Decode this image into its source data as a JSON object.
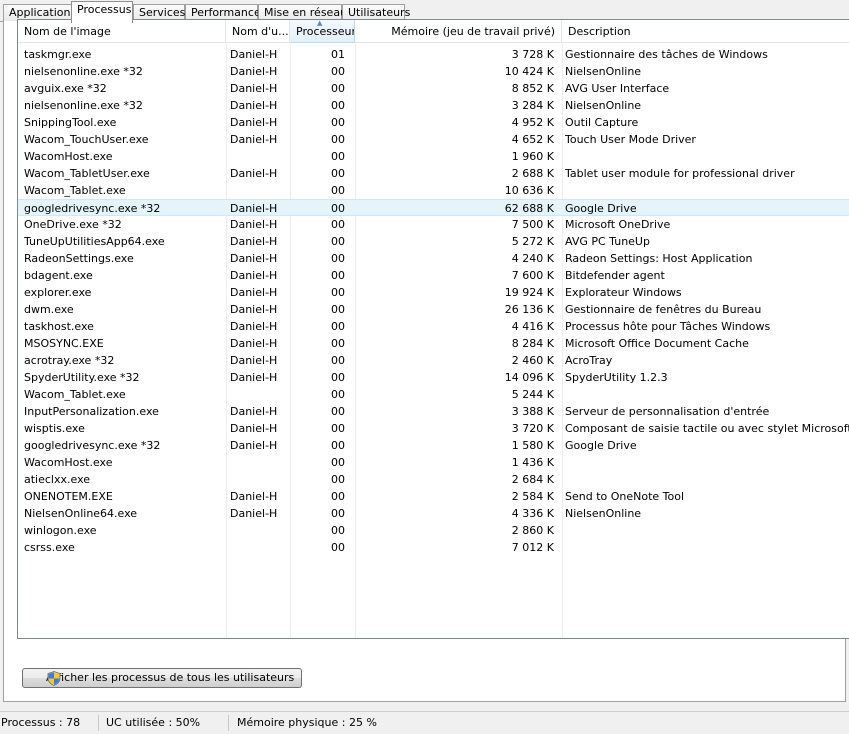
{
  "tabs": [
    {
      "label": "Applications",
      "active": false
    },
    {
      "label": "Processus",
      "active": true
    },
    {
      "label": "Services",
      "active": false
    },
    {
      "label": "Performance",
      "active": false
    },
    {
      "label": "Mise en réseau",
      "active": false
    },
    {
      "label": "Utilisateurs",
      "active": false
    }
  ],
  "columns": {
    "name": "Nom de l'image",
    "user": "Nom d'u...",
    "cpu": "Processeur",
    "mem": "Mémoire (jeu de travail privé)",
    "desc": "Description"
  },
  "sorted_column": "cpu",
  "selected_row": 9,
  "rows": [
    {
      "name": "taskmgr.exe",
      "user": "Daniel-H",
      "cpu": "01",
      "mem": "3 728 K",
      "desc": "Gestionnaire des tâches de Windows"
    },
    {
      "name": "nielsenonline.exe *32",
      "user": "Daniel-H",
      "cpu": "00",
      "mem": "10 424 K",
      "desc": "NielsenOnline"
    },
    {
      "name": "avguix.exe *32",
      "user": "Daniel-H",
      "cpu": "00",
      "mem": "8 852 K",
      "desc": "AVG User Interface"
    },
    {
      "name": "nielsenonline.exe *32",
      "user": "Daniel-H",
      "cpu": "00",
      "mem": "3 284 K",
      "desc": "NielsenOnline"
    },
    {
      "name": "SnippingTool.exe",
      "user": "Daniel-H",
      "cpu": "00",
      "mem": "4 952 K",
      "desc": "Outil Capture"
    },
    {
      "name": "Wacom_TouchUser.exe",
      "user": "Daniel-H",
      "cpu": "00",
      "mem": "4 652 K",
      "desc": "Touch User Mode Driver"
    },
    {
      "name": "WacomHost.exe",
      "user": "",
      "cpu": "00",
      "mem": "1 960 K",
      "desc": ""
    },
    {
      "name": "Wacom_TabletUser.exe",
      "user": "Daniel-H",
      "cpu": "00",
      "mem": "2 688 K",
      "desc": "Tablet user module for professional driver"
    },
    {
      "name": "Wacom_Tablet.exe",
      "user": "",
      "cpu": "00",
      "mem": "10 636 K",
      "desc": ""
    },
    {
      "name": "googledrivesync.exe *32",
      "user": "Daniel-H",
      "cpu": "00",
      "mem": "62 688 K",
      "desc": "Google Drive"
    },
    {
      "name": "OneDrive.exe *32",
      "user": "Daniel-H",
      "cpu": "00",
      "mem": "7 500 K",
      "desc": "Microsoft OneDrive"
    },
    {
      "name": "TuneUpUtilitiesApp64.exe",
      "user": "Daniel-H",
      "cpu": "00",
      "mem": "5 272 K",
      "desc": "AVG PC TuneUp"
    },
    {
      "name": "RadeonSettings.exe",
      "user": "Daniel-H",
      "cpu": "00",
      "mem": "4 240 K",
      "desc": "Radeon Settings: Host Application"
    },
    {
      "name": "bdagent.exe",
      "user": "Daniel-H",
      "cpu": "00",
      "mem": "7 600 K",
      "desc": "Bitdefender agent"
    },
    {
      "name": "explorer.exe",
      "user": "Daniel-H",
      "cpu": "00",
      "mem": "19 924 K",
      "desc": "Explorateur Windows"
    },
    {
      "name": "dwm.exe",
      "user": "Daniel-H",
      "cpu": "00",
      "mem": "26 136 K",
      "desc": "Gestionnaire de fenêtres du Bureau"
    },
    {
      "name": "taskhost.exe",
      "user": "Daniel-H",
      "cpu": "00",
      "mem": "4 416 K",
      "desc": "Processus hôte pour Tâches Windows"
    },
    {
      "name": "MSOSYNC.EXE",
      "user": "Daniel-H",
      "cpu": "00",
      "mem": "8 284 K",
      "desc": "Microsoft Office Document Cache"
    },
    {
      "name": "acrotray.exe *32",
      "user": "Daniel-H",
      "cpu": "00",
      "mem": "2 460 K",
      "desc": "AcroTray"
    },
    {
      "name": "SpyderUtility.exe *32",
      "user": "Daniel-H",
      "cpu": "00",
      "mem": "14 096 K",
      "desc": "SpyderUtility 1.2.3"
    },
    {
      "name": "Wacom_Tablet.exe",
      "user": "",
      "cpu": "00",
      "mem": "5 244 K",
      "desc": ""
    },
    {
      "name": "InputPersonalization.exe",
      "user": "Daniel-H",
      "cpu": "00",
      "mem": "3 388 K",
      "desc": "Serveur de personnalisation d'entrée"
    },
    {
      "name": "wisptis.exe",
      "user": "Daniel-H",
      "cpu": "00",
      "mem": "3 720 K",
      "desc": "Composant de saisie tactile ou avec stylet Microsoft"
    },
    {
      "name": "googledrivesync.exe *32",
      "user": "Daniel-H",
      "cpu": "00",
      "mem": "1 580 K",
      "desc": "Google Drive"
    },
    {
      "name": "WacomHost.exe",
      "user": "",
      "cpu": "00",
      "mem": "1 436 K",
      "desc": ""
    },
    {
      "name": "atieclxx.exe",
      "user": "",
      "cpu": "00",
      "mem": "2 684 K",
      "desc": ""
    },
    {
      "name": "ONENOTEM.EXE",
      "user": "Daniel-H",
      "cpu": "00",
      "mem": "2 584 K",
      "desc": "Send to OneNote Tool"
    },
    {
      "name": "NielsenOnline64.exe",
      "user": "Daniel-H",
      "cpu": "00",
      "mem": "4 336 K",
      "desc": "NielsenOnline"
    },
    {
      "name": "winlogon.exe",
      "user": "",
      "cpu": "00",
      "mem": "2 860 K",
      "desc": ""
    },
    {
      "name": "csrss.exe",
      "user": "",
      "cpu": "00",
      "mem": "7 012 K",
      "desc": ""
    }
  ],
  "button": {
    "label": "Afficher les processus de tous les utilisateurs",
    "icon": "uac-shield-icon"
  },
  "status": {
    "processes": "Processus : 78",
    "cpu": "UC utilisée : 50%",
    "memory": "Mémoire physique : 25 %"
  },
  "colors": {
    "selection": "#e5f3fb",
    "sorted_header": "#e3f0fa",
    "panel_bg": "#ffffff",
    "window_bg": "#f0f0f0"
  }
}
